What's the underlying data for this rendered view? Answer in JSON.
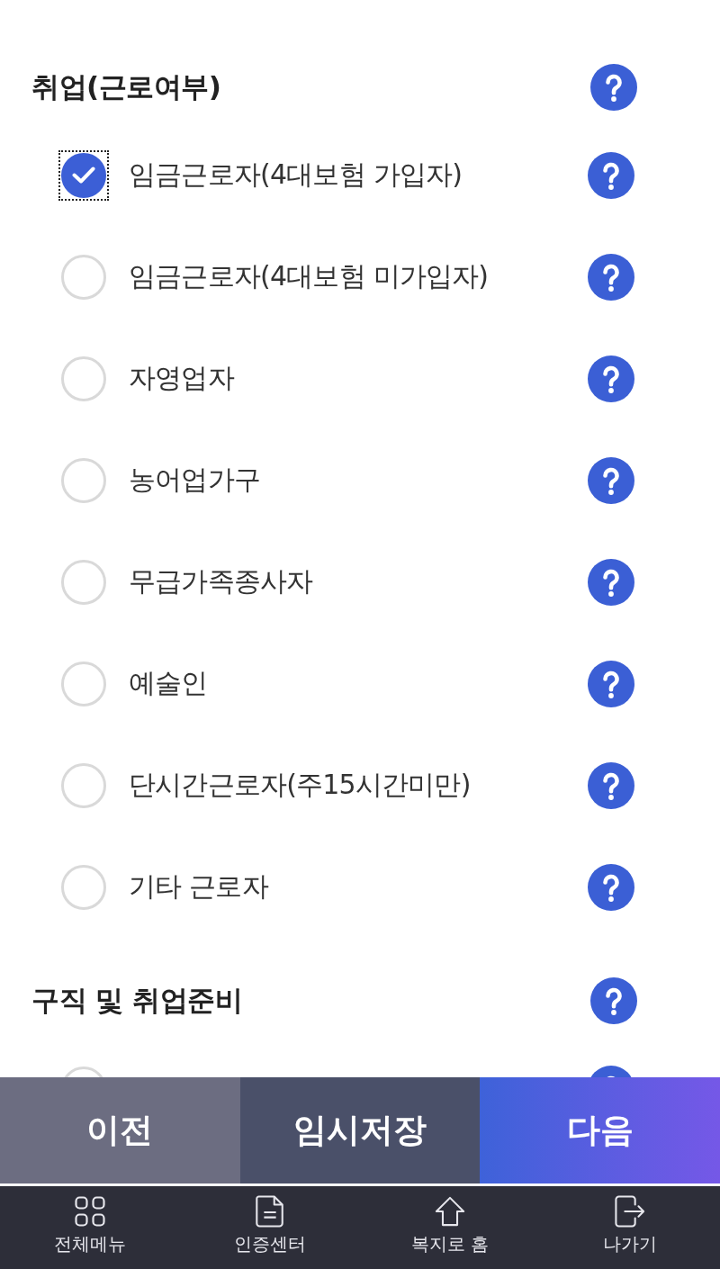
{
  "sections": [
    {
      "title": "취업(근로여부)",
      "options": [
        {
          "label": "임금근로자(4대보험 가입자)",
          "selected": true,
          "focused": true
        },
        {
          "label": "임금근로자(4대보험 미가입자)",
          "selected": false,
          "focused": false
        },
        {
          "label": "자영업자",
          "selected": false,
          "focused": false
        },
        {
          "label": "농어업가구",
          "selected": false,
          "focused": false
        },
        {
          "label": "무급가족종사자",
          "selected": false,
          "focused": false
        },
        {
          "label": "예술인",
          "selected": false,
          "focused": false
        },
        {
          "label": "단시간근로자(주15시간미만)",
          "selected": false,
          "focused": false
        },
        {
          "label": "기타 근로자",
          "selected": false,
          "focused": false
        }
      ]
    },
    {
      "title": "구직 및 취업준비",
      "options": [
        {
          "selected": false,
          "focused": false
        }
      ]
    }
  ],
  "actions": [
    {
      "label": "이전",
      "kind": "back"
    },
    {
      "label": "임시저장",
      "kind": "save"
    },
    {
      "label": "다음",
      "kind": "next"
    }
  ],
  "nav": [
    {
      "label": "전체메뉴"
    },
    {
      "label": "인증센터"
    },
    {
      "label": "복지로 홈"
    },
    {
      "label": "나가기"
    }
  ]
}
